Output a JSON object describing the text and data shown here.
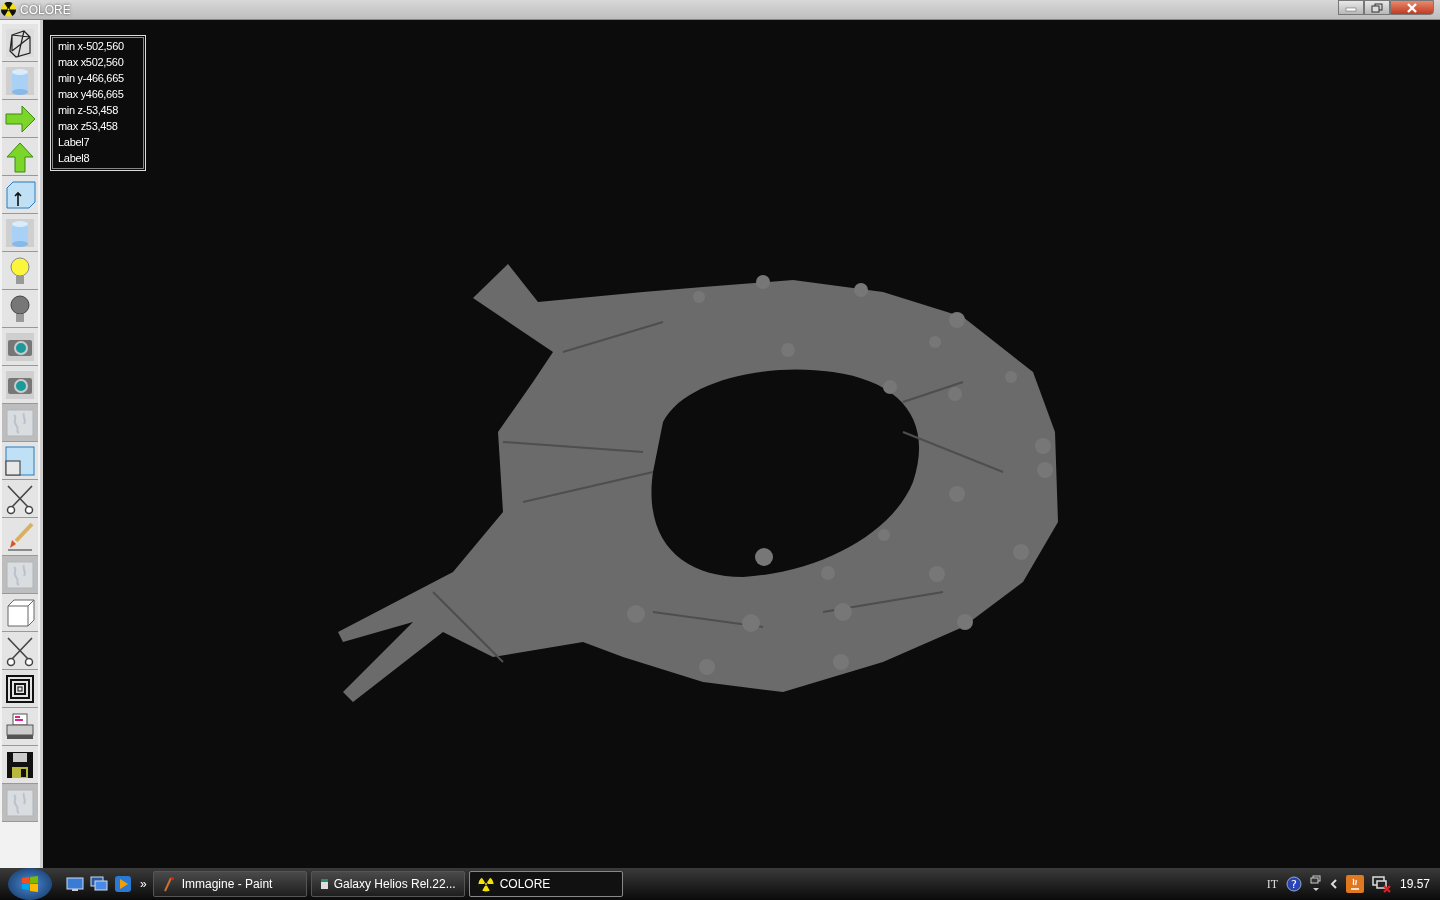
{
  "window": {
    "title": "COLORE"
  },
  "toolbar": [
    {
      "kind": "wireframe",
      "disabled": false
    },
    {
      "kind": "cylinder",
      "disabled": false
    },
    {
      "kind": "arrow-right",
      "disabled": false
    },
    {
      "kind": "arrow-up",
      "disabled": false
    },
    {
      "kind": "box-arrow",
      "disabled": false
    },
    {
      "kind": "cylinder",
      "disabled": false
    },
    {
      "kind": "bulb-on",
      "disabled": false
    },
    {
      "kind": "bulb-off",
      "disabled": false
    },
    {
      "kind": "camera",
      "disabled": false
    },
    {
      "kind": "camera",
      "disabled": false
    },
    {
      "kind": "blank",
      "disabled": true
    },
    {
      "kind": "panel",
      "disabled": false
    },
    {
      "kind": "scissors",
      "disabled": false
    },
    {
      "kind": "brush",
      "disabled": false
    },
    {
      "kind": "blank",
      "disabled": true
    },
    {
      "kind": "cube",
      "disabled": false
    },
    {
      "kind": "scissors",
      "disabled": false
    },
    {
      "kind": "squares",
      "disabled": false
    },
    {
      "kind": "printer",
      "disabled": false
    },
    {
      "kind": "floppy",
      "disabled": false
    },
    {
      "kind": "blank",
      "disabled": true
    }
  ],
  "info_panel": [
    "min x-502,560",
    "max x502,560",
    "min y-466,665",
    "max y466,665",
    "min z-53,458",
    "max z53,458",
    "Label7",
    "Label8"
  ],
  "taskbar": {
    "quick_launch": [
      {
        "kind": "desktop"
      },
      {
        "kind": "windows"
      },
      {
        "kind": "media"
      }
    ],
    "overflow": "»",
    "tasks": [
      {
        "label": "Immagine - Paint",
        "kind": "paint",
        "selected": false
      },
      {
        "label": "Galaxy Helios  Rel.22...",
        "kind": "app",
        "selected": false
      },
      {
        "label": "COLORE",
        "kind": "radiation",
        "selected": true
      }
    ],
    "tray": {
      "language": "IT",
      "help": "?",
      "clock": "19.57"
    }
  }
}
